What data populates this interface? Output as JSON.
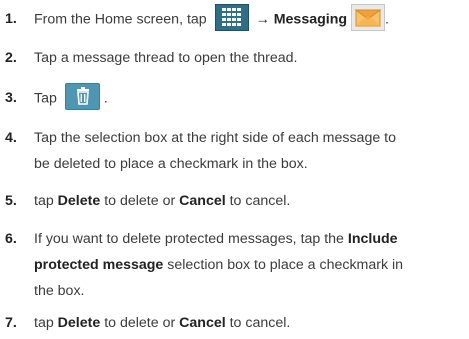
{
  "steps": [
    {
      "num": "1.",
      "parts": {
        "text_a": "From the Home screen, tap ",
        "arrow": "→",
        "bold_a": "Messaging",
        "end": "."
      }
    },
    {
      "num": "2.",
      "parts": {
        "text_a": "Tap a message thread to open the thread."
      }
    },
    {
      "num": "3.",
      "parts": {
        "text_a": "Tap ",
        "end": "."
      }
    },
    {
      "num": "4.",
      "parts": {
        "line1": "Tap the selection box at the right side of each message to",
        "line2": "be deleted to place a checkmark in the box."
      }
    },
    {
      "num": "5.",
      "parts": {
        "text_a": "tap ",
        "bold_a": "Delete",
        "text_b": " to delete or ",
        "bold_b": "Cancel",
        "text_c": " to cancel."
      }
    },
    {
      "num": "6.",
      "parts": {
        "text_a": "If you want to delete protected messages, tap the ",
        "bold_a": "Include",
        "bold_b": "protected message",
        "text_b": " selection box to place a checkmark in",
        "text_c": "the box."
      }
    },
    {
      "num": "7.",
      "parts": {
        "text_a": "tap ",
        "bold_a": "Delete",
        "text_b": " to delete or ",
        "bold_b": "Cancel",
        "text_c": " to cancel."
      }
    }
  ],
  "icons": {
    "apps": "apps-grid-icon",
    "messaging": "messaging-envelope-icon",
    "delete": "trash-icon"
  },
  "colors": {
    "apps_bg": "#2d6f89",
    "trash_bg": "#4f96b3",
    "envelope_orange": "#f0a23a"
  }
}
